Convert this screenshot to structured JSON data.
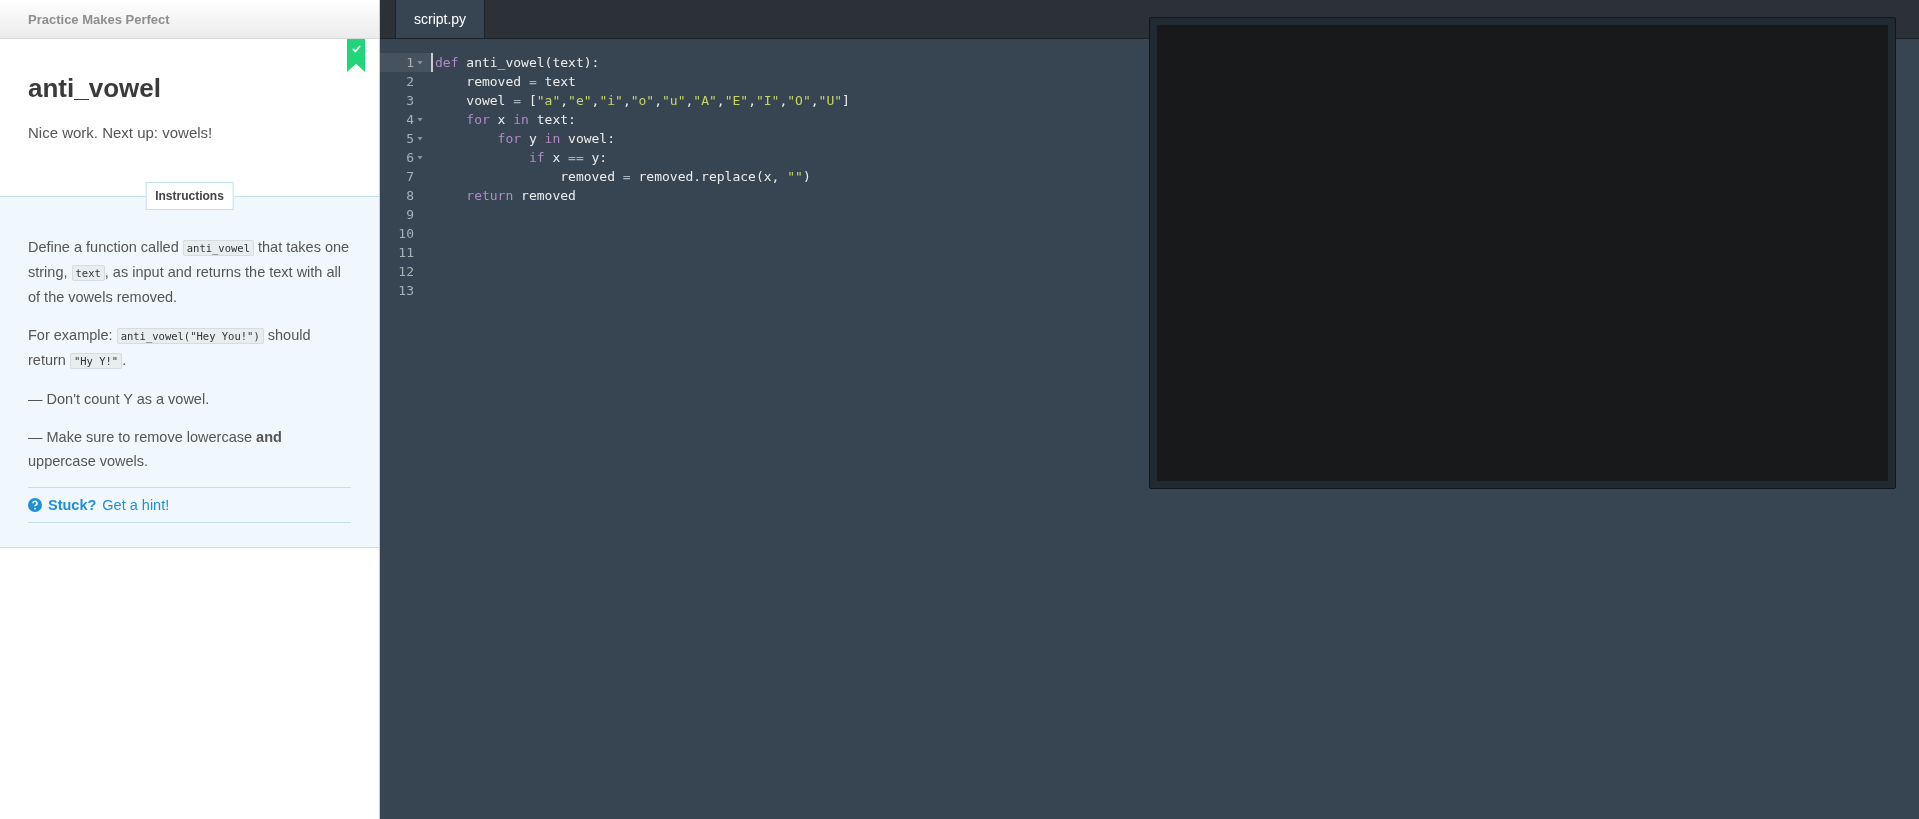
{
  "course_header": {
    "title": "Practice Makes Perfect"
  },
  "lesson": {
    "title": "anti_vowel",
    "completed": true,
    "subtitle": "Nice work. Next up: vowels!"
  },
  "instructions": {
    "tab_label": "Instructions",
    "paragraphs": [
      [
        {
          "kind": "text",
          "text": "Define a function called "
        },
        {
          "kind": "code",
          "text": "anti_vowel"
        },
        {
          "kind": "text",
          "text": " that takes one string, "
        },
        {
          "kind": "code",
          "text": "text"
        },
        {
          "kind": "text",
          "text": ", as input and returns the text with all of the vowels removed."
        }
      ],
      [
        {
          "kind": "text",
          "text": "For example: "
        },
        {
          "kind": "code",
          "text": "anti_vowel(\"Hey You!\")"
        },
        {
          "kind": "text",
          "text": " should return "
        },
        {
          "kind": "code",
          "text": "\"Hy Y!\""
        },
        {
          "kind": "text",
          "text": "."
        }
      ],
      [
        {
          "kind": "text",
          "text": "— Don't count Y as a vowel."
        }
      ],
      [
        {
          "kind": "text",
          "text": "— Make sure to remove lowercase **and** uppercase vowels."
        }
      ]
    ],
    "hint_label": "Stuck?",
    "hint_link": "Get a hint!"
  },
  "editor": {
    "tabs": [
      {
        "label": "script.py",
        "selected": true
      }
    ],
    "lines": [
      {
        "number": "1",
        "foldable": true,
        "active": true,
        "tokens": [
          {
            "kind": "keyword",
            "text": "def"
          },
          {
            "kind": "plain",
            "text": " anti_vowel(text):"
          }
        ]
      },
      {
        "number": "2",
        "foldable": false,
        "active": false,
        "tokens": [
          {
            "kind": "plain",
            "text": "    removed "
          },
          {
            "kind": "operator",
            "text": "="
          },
          {
            "kind": "plain",
            "text": " text"
          }
        ]
      },
      {
        "number": "3",
        "foldable": false,
        "active": false,
        "tokens": [
          {
            "kind": "plain",
            "text": "    vowel "
          },
          {
            "kind": "operator",
            "text": "="
          },
          {
            "kind": "plain",
            "text": " ["
          },
          {
            "kind": "string",
            "text": "\"a\""
          },
          {
            "kind": "plain",
            "text": ","
          },
          {
            "kind": "string",
            "text": "\"e\""
          },
          {
            "kind": "plain",
            "text": ","
          },
          {
            "kind": "string",
            "text": "\"i\""
          },
          {
            "kind": "plain",
            "text": ","
          },
          {
            "kind": "string",
            "text": "\"o\""
          },
          {
            "kind": "plain",
            "text": ","
          },
          {
            "kind": "string",
            "text": "\"u\""
          },
          {
            "kind": "plain",
            "text": ","
          },
          {
            "kind": "string",
            "text": "\"A\""
          },
          {
            "kind": "plain",
            "text": ","
          },
          {
            "kind": "string",
            "text": "\"E\""
          },
          {
            "kind": "plain",
            "text": ","
          },
          {
            "kind": "string",
            "text": "\"I\""
          },
          {
            "kind": "plain",
            "text": ","
          },
          {
            "kind": "string",
            "text": "\"O\""
          },
          {
            "kind": "plain",
            "text": ","
          },
          {
            "kind": "string",
            "text": "\"U\""
          },
          {
            "kind": "plain",
            "text": "]"
          }
        ]
      },
      {
        "number": "4",
        "foldable": true,
        "active": false,
        "tokens": [
          {
            "kind": "keyword",
            "text": "    for"
          },
          {
            "kind": "plain",
            "text": " x "
          },
          {
            "kind": "keyword",
            "text": "in"
          },
          {
            "kind": "plain",
            "text": " text:"
          }
        ]
      },
      {
        "number": "5",
        "foldable": true,
        "active": false,
        "tokens": [
          {
            "kind": "keyword",
            "text": "        for"
          },
          {
            "kind": "plain",
            "text": " y "
          },
          {
            "kind": "keyword",
            "text": "in"
          },
          {
            "kind": "plain",
            "text": " vowel:"
          }
        ]
      },
      {
        "number": "6",
        "foldable": true,
        "active": false,
        "tokens": [
          {
            "kind": "keyword",
            "text": "            if"
          },
          {
            "kind": "plain",
            "text": " x "
          },
          {
            "kind": "operator",
            "text": "=="
          },
          {
            "kind": "plain",
            "text": " y:"
          }
        ]
      },
      {
        "number": "7",
        "foldable": false,
        "active": false,
        "tokens": [
          {
            "kind": "plain",
            "text": "                removed "
          },
          {
            "kind": "operator",
            "text": "="
          },
          {
            "kind": "plain",
            "text": " removed.replace(x, "
          },
          {
            "kind": "string",
            "text": "\"\""
          },
          {
            "kind": "plain",
            "text": ")"
          }
        ]
      },
      {
        "number": "8",
        "foldable": false,
        "active": false,
        "tokens": [
          {
            "kind": "keyword",
            "text": "    return"
          },
          {
            "kind": "plain",
            "text": " removed"
          }
        ]
      },
      {
        "number": "9",
        "foldable": false,
        "active": false
      },
      {
        "number": "10",
        "foldable": false,
        "active": false
      },
      {
        "number": "11",
        "foldable": false,
        "active": false
      },
      {
        "number": "12",
        "foldable": false,
        "active": false
      },
      {
        "number": "13",
        "foldable": false,
        "active": false
      }
    ]
  }
}
